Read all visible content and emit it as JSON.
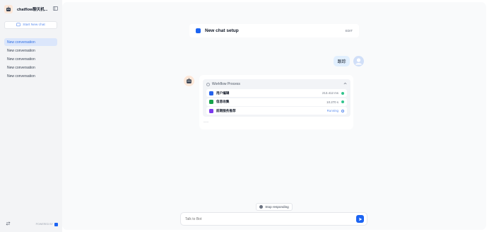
{
  "sidebar": {
    "app_name": "chatflow聊天机...",
    "new_chat_label": "Start New chat",
    "conversations": [
      {
        "label": "New conversation",
        "active": true
      },
      {
        "label": "New conversation",
        "active": false
      },
      {
        "label": "New conversation",
        "active": false
      },
      {
        "label": "New conversation",
        "active": false
      },
      {
        "label": "New conversation",
        "active": false
      }
    ],
    "powered_by": "POWERED BY"
  },
  "setup": {
    "title": "New chat setup",
    "edit_label": "EDIT"
  },
  "chat": {
    "user_message": "跟踪",
    "workflow": {
      "title": "Workflow Process",
      "nodes": [
        {
          "name": "用户编辑",
          "time": "213.412 ms",
          "status": "success",
          "icon": "start-node-icon",
          "color": "#2563eb"
        },
        {
          "name": "信息收集",
          "time": "10.270 s",
          "status": "success",
          "icon": "llm-node-icon",
          "color": "#16a34a"
        },
        {
          "name": "前期服务推荐",
          "time": "Running",
          "status": "running",
          "icon": "code-node-icon",
          "color": "#7c3aed"
        }
      ]
    },
    "typing_indicator": "···"
  },
  "composer": {
    "stop_label": "Stop responding",
    "placeholder": "Talk to Bot"
  }
}
